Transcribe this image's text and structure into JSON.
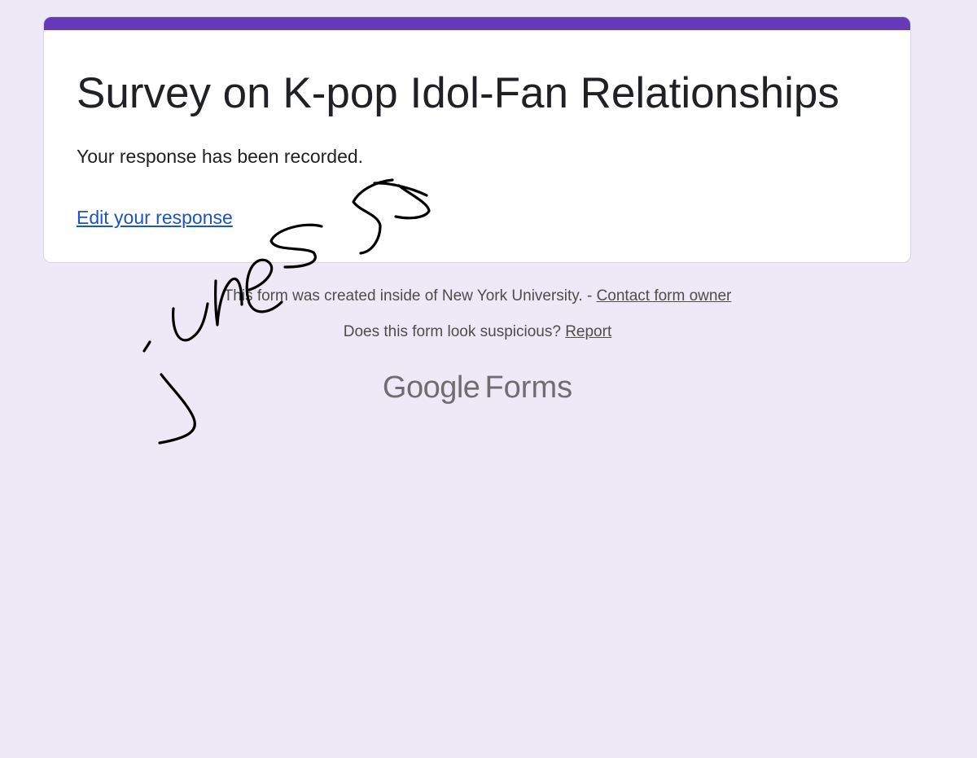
{
  "form": {
    "title": "Survey on K-pop Idol-Fan Relationships",
    "confirmation": "Your response has been recorded.",
    "edit_link": "Edit your response",
    "accent_color": "#673ab7",
    "background_color": "#ede9f7"
  },
  "footer": {
    "org_notice": "This form was created inside of New York University. - ",
    "contact_link": "Contact form owner",
    "suspicious_text": "Does this form look suspicious? ",
    "report_link": "Report",
    "brand_google": "Google",
    "brand_product": "Forms"
  },
  "overlay": {
    "signature_text": "jiness5"
  }
}
